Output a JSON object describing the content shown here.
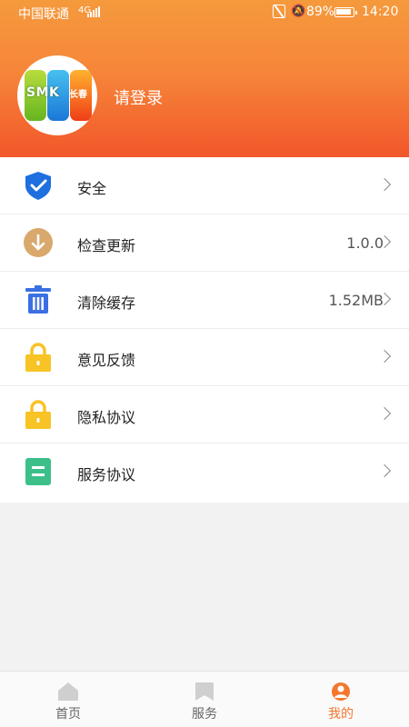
{
  "status_bar": {
    "carrier": "中国联通",
    "signal_type": "4G",
    "battery_percent": "89%",
    "time": "14:20"
  },
  "profile": {
    "avatar_logo_text": "SMK",
    "avatar_logo_sub": "长春",
    "login_prompt": "请登录"
  },
  "menu": {
    "items": [
      {
        "label": "安全",
        "value": "",
        "icon": "shield-check-icon"
      },
      {
        "label": "检查更新",
        "value": "1.0.0",
        "icon": "download-arrow-icon"
      },
      {
        "label": "清除缓存",
        "value": "1.52MB",
        "icon": "trash-icon"
      },
      {
        "label": "意见反馈",
        "value": "",
        "icon": "lock-icon"
      },
      {
        "label": "隐私协议",
        "value": "",
        "icon": "lock-icon"
      },
      {
        "label": "服务协议",
        "value": "",
        "icon": "document-icon"
      }
    ]
  },
  "tabbar": {
    "tabs": [
      {
        "label": "首页",
        "icon": "home-icon",
        "active": false
      },
      {
        "label": "服务",
        "icon": "bookmark-icon",
        "active": false
      },
      {
        "label": "我的",
        "icon": "person-icon",
        "active": true
      }
    ]
  },
  "colors": {
    "header_top": "#f59a3c",
    "header_bottom": "#f2572a",
    "shield_blue": "#1e6fe0",
    "update_tan": "#d9a86c",
    "trash_blue": "#3b6fe3",
    "lock_yellow": "#f7c325",
    "doc_green": "#3dbf8a",
    "active_tab": "#f3782e"
  }
}
